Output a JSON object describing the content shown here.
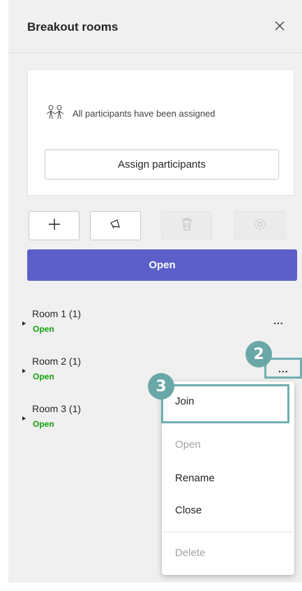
{
  "header": {
    "title": "Breakout rooms",
    "close_icon": "close-icon"
  },
  "assign_card": {
    "status_text": "All participants have been assigned",
    "status_icon": "people-group-icon",
    "assign_button_label": "Assign participants"
  },
  "toolbar": {
    "add_icon": "plus-icon",
    "announce_icon": "megaphone-icon",
    "delete_icon": "trash-icon",
    "settings_icon": "gear-icon"
  },
  "open_button_label": "Open",
  "rooms": [
    {
      "name": "Room 1  (1)",
      "status": "Open",
      "more": "..."
    },
    {
      "name": "Room 2  (1)",
      "status": "Open",
      "more": "..."
    },
    {
      "name": "Room 3  (1)",
      "status": "Open"
    }
  ],
  "context_menu": {
    "join": "Join",
    "open": "Open",
    "rename": "Rename",
    "close": "Close",
    "delete": "Delete"
  },
  "callouts": {
    "step2": "2",
    "step3": "3"
  },
  "colors": {
    "primary": "#5b5fc7",
    "open_status": "#13a10e",
    "callout": "#6aa7a7"
  }
}
